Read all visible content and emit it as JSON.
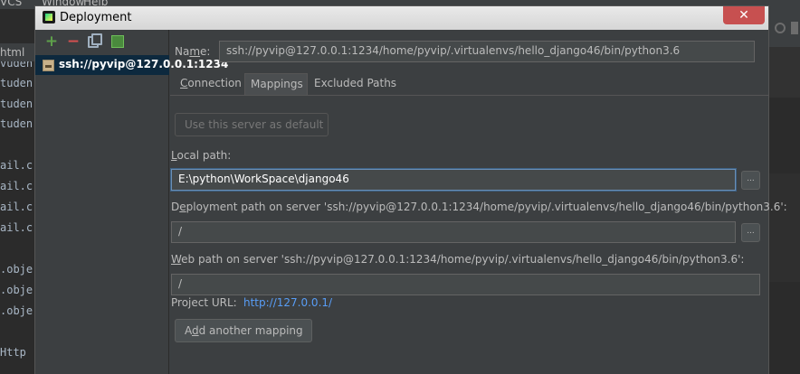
{
  "ide": {
    "menu_items": [
      "VCS",
      "Window",
      "Help"
    ],
    "left_tab": "html",
    "code_lines": [
      "vudent",
      "tuden",
      "tuden",
      "tuden",
      "",
      "ail.c",
      "ail.c",
      "ail.c",
      "ail.c",
      "",
      ".obje",
      ".obje",
      ".obje",
      "",
      " Http"
    ]
  },
  "dialog": {
    "title": "Deployment",
    "close_symbol": "✕",
    "toolbar": {
      "add_symbol": "+",
      "remove_symbol": "−"
    },
    "servers": [
      {
        "label": "ssh://pyvip@127.0.0.1:1234",
        "selected": true
      }
    ],
    "name": {
      "label_prefix": "Na",
      "label_mnemonic": "m",
      "label_suffix": "e:",
      "value": "ssh://pyvip@127.0.0.1:1234/home/pyvip/.virtualenvs/hello_django46/bin/python3.6"
    },
    "tabs": {
      "connection": {
        "mnemonic": "C",
        "rest": "onnection"
      },
      "mappings": {
        "label": "Mappings"
      },
      "excluded": {
        "label": "Excluded Paths"
      }
    },
    "mappings": {
      "use_default_button": "Use this server as default",
      "local_path": {
        "mnemonic": "L",
        "label_rest": "ocal path:",
        "value": "E:\\python\\WorkSpace\\django46"
      },
      "deployment_path": {
        "label_first": "D",
        "mnemonic": "e",
        "label_rest": "ployment path on server 'ssh://pyvip@127.0.0.1:1234/home/pyvip/.virtualenvs/hello_django46/bin/python3.6':",
        "value": "/"
      },
      "web_path": {
        "mnemonic": "W",
        "label_rest": "eb path on server 'ssh://pyvip@127.0.0.1:1234/home/pyvip/.virtualenvs/hello_django46/bin/python3.6':",
        "value": "/"
      },
      "browse_label": "...",
      "project_url_label": "Project URL:",
      "project_url_value": "http://127.0.0.1/",
      "add_mapping": {
        "first": "A",
        "mnemonic": "d",
        "rest": "d another mapping"
      }
    }
  },
  "colors": {
    "accent": "#589df6",
    "selection": "#0d293e",
    "close_red": "#c75050"
  }
}
